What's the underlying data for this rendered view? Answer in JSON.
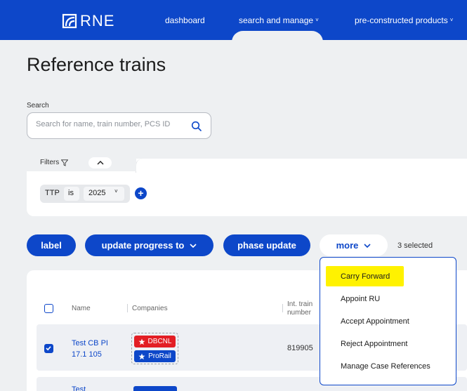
{
  "nav": {
    "logo_text": "RNE",
    "dashboard": "dashboard",
    "search_manage": "search and manage",
    "pre_constructed": "pre-constructed products"
  },
  "page": {
    "title": "Reference trains"
  },
  "search": {
    "label": "Search",
    "placeholder": "Search for name, train number, PCS ID"
  },
  "filters": {
    "label": "Filters",
    "chip": {
      "field": "TTP",
      "operator": "is",
      "value": "2025"
    }
  },
  "actions": {
    "label": "label",
    "update_progress": "update progress to",
    "phase_update": "phase update",
    "more": "more",
    "selected": "3 selected"
  },
  "table": {
    "headers": {
      "name": "Name",
      "companies": "Companies",
      "int_train_number": "Int. train\nnumber"
    },
    "rows": [
      {
        "name": "Test CB PI 17.1 105",
        "companies": [
          "DBCNL",
          "ProRail"
        ],
        "int_train_number": "819905",
        "checked": true
      },
      {
        "name": "Test",
        "companies": [],
        "int_train_number": "",
        "checked": false
      }
    ]
  },
  "menu": {
    "items": [
      "Carry Forward",
      "Appoint RU",
      "Accept Appointment",
      "Reject Appointment",
      "Manage Case References"
    ]
  },
  "colors": {
    "brand": "#0d47c9",
    "badge_red": "#e31e24",
    "highlight": "#fff200"
  }
}
